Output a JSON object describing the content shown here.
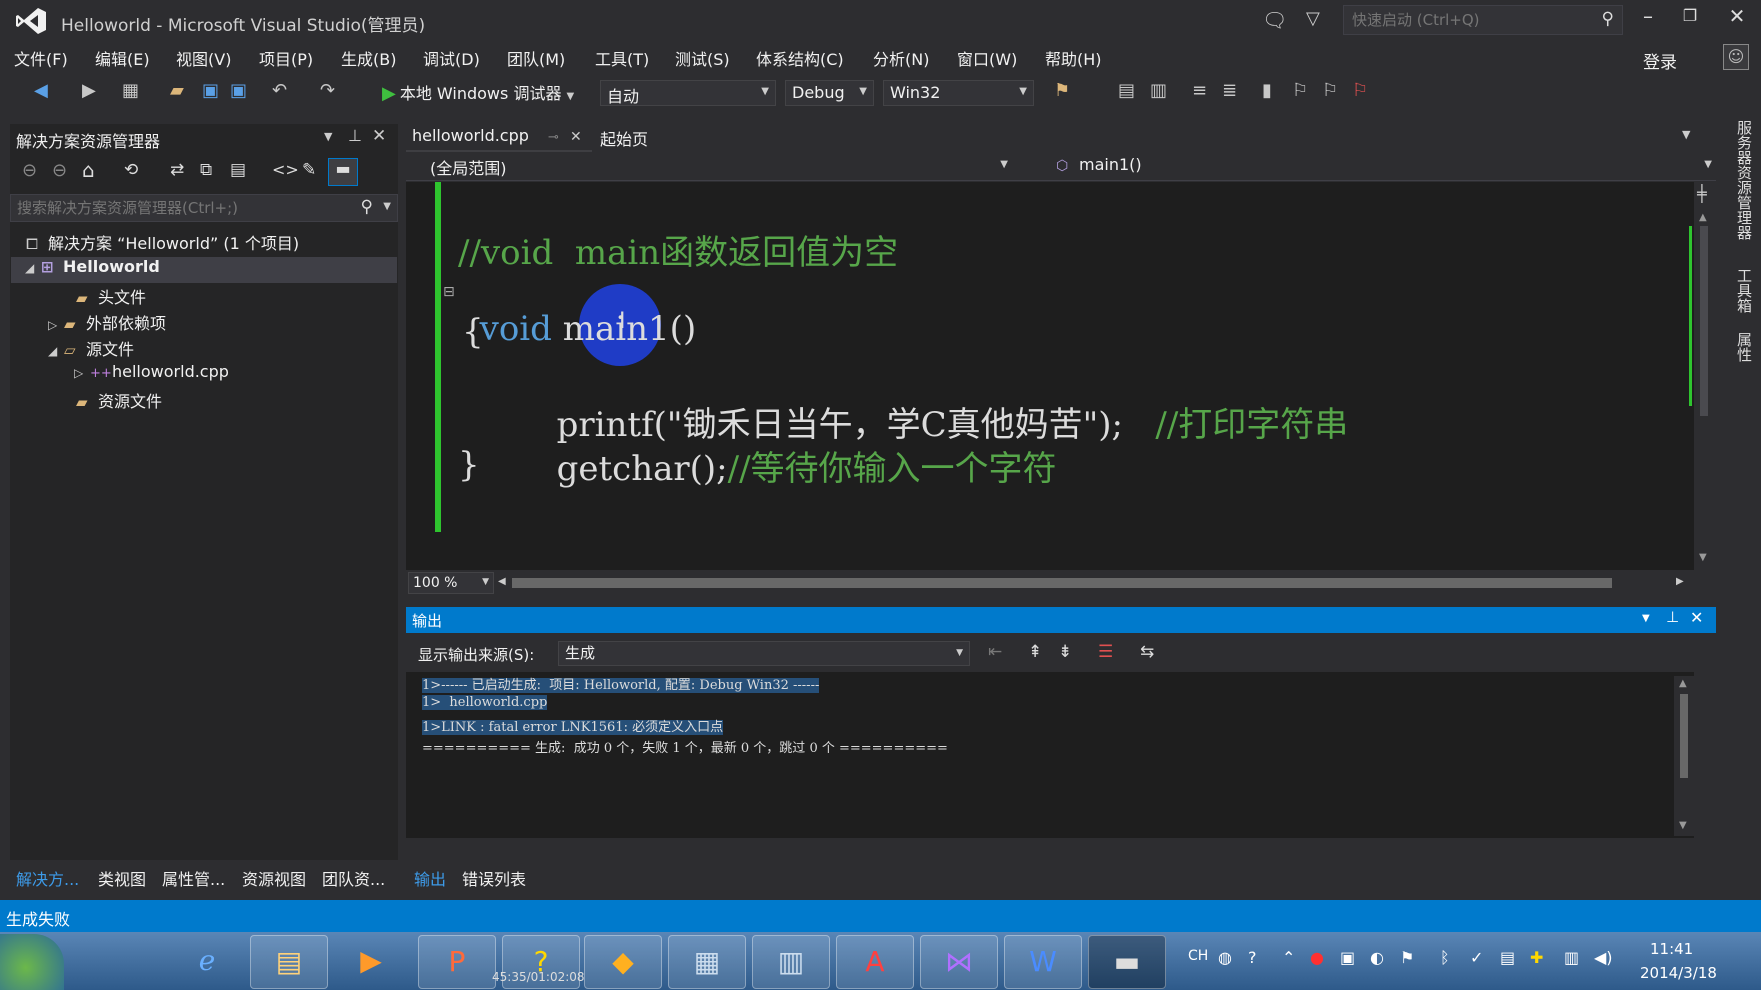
{
  "window": {
    "title": "Helloworld - Microsoft Visual Studio(管理员)",
    "quick_launch_placeholder": "快速启动 (Ctrl+Q)",
    "login": "登录"
  },
  "menu": [
    "文件(F)",
    "编辑(E)",
    "视图(V)",
    "项目(P)",
    "生成(B)",
    "调试(D)",
    "团队(M)",
    "工具(T)",
    "测试(S)",
    "体系结构(C)",
    "分析(N)",
    "窗口(W)",
    "帮助(H)"
  ],
  "toolbar": {
    "run_label": "本地 Windows 调试器",
    "auto_combo": "自动",
    "config_combo": "Debug",
    "platform_combo": "Win32"
  },
  "solution_explorer": {
    "title": "解决方案资源管理器",
    "search_placeholder": "搜索解决方案资源管理器(Ctrl+;)",
    "tree": {
      "solution": "解决方案 “Helloworld” (1 个项目)",
      "project": "Helloworld",
      "headers": "头文件",
      "external": "外部依赖项",
      "sources": "源文件",
      "cpp": "helloworld.cpp",
      "resources": "资源文件"
    }
  },
  "editor": {
    "tab_active": "helloworld.cpp",
    "tab_start": "起始页",
    "scope": "(全局范围)",
    "member": "main1()",
    "zoom": "100 %",
    "code": {
      "line1": "//void  main函数返回值为空",
      "line2_kw": "void",
      "line2_rest": " main1()",
      "line3": "{",
      "line4_code": "printf(\"锄禾日当午，学C真他妈苦\");",
      "line4_cmt": "//打印字符串",
      "line5_code": "getchar();",
      "line5_cmt": "//等待你输入一个字符",
      "line6": "}"
    }
  },
  "output": {
    "title": "输出",
    "source_label": "显示输出来源(S):",
    "source_value": "生成",
    "lines": [
      "1>------ 已启动生成:  项目: Helloworld, 配置: Debug Win32 ------",
      "1>  helloworld.cpp",
      "1>LINK : fatal error LNK1561: 必须定义入口点",
      "========== 生成:  成功 0 个，失败 1 个，最新 0 个，跳过 0 个 =========="
    ]
  },
  "bottom_tabs_left": [
    "解决方...",
    "类视图",
    "属性管...",
    "资源视图",
    "团队资..."
  ],
  "bottom_tabs_right": [
    "输出",
    "错误列表"
  ],
  "right_rail": [
    "服务器资源管理器",
    "工具箱",
    "属性"
  ],
  "status": "生成失败",
  "taskbar": {
    "lang": "CH",
    "time": "11:41",
    "date": "2014/3/18",
    "video_time": "45:35/01:02:08"
  },
  "colors": {
    "accent": "#007acc",
    "editor_bg": "#1e1e1e",
    "keyword": "#569cd6",
    "comment": "#57a64a",
    "change_bar": "#2ec42e"
  }
}
